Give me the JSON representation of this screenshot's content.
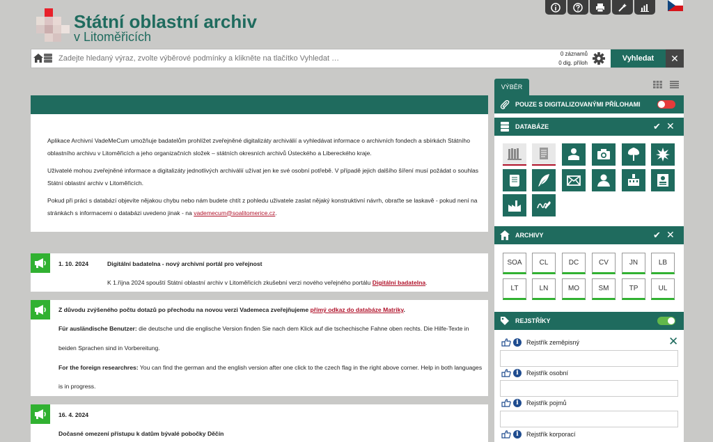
{
  "header": {
    "title_line1": "Státní oblastní archiv",
    "title_line2": "v Litoměřicích",
    "top_icons": [
      "info-icon",
      "help-icon",
      "print-icon",
      "magic-wand-icon",
      "chart-icon"
    ],
    "flag": "czech-flag-icon"
  },
  "search": {
    "placeholder": "Zadejte hledaný výraz, zvolte výběrové podmínky a klikněte na tlačítko Vyhledat …",
    "records": "0 záznamů",
    "attachments": "0 dig. příloh",
    "button": "Vyhledat",
    "clear": "✕"
  },
  "intro": {
    "p1": "Aplikace Archivní VadeMeCum umožňuje badatelům prohlížet zveřejněné digitalizáty archiválií a vyhledávat informace o archivních fondech a sbírkách Státního oblastního archivu v Litoměřicích a jeho organizačních složek – státních okresních archivů Ústeckého a Libereckého kraje.",
    "p2": "Uživatelé mohou zveřejněné informace a digitalizáty jednotlivých archiválií užívat jen ke své osobní potřebě. V případě jejich dalšího šíření musí požádat o souhlas Státní oblastní archiv v Litoměřicích.",
    "p3_before": "Pokud při práci s databází objevíte nějakou chybu nebo nám budete chtít z pohledu uživatele zaslat nějaký konstruktivní návrh, obraťte se laskavě - pokud není na stránkách s informacemi o databázi uvedeno jinak - na ",
    "p3_link": "vademecum@soalitomerice.cz",
    "p3_after": "."
  },
  "news": [
    {
      "date": "1. 10. 2024",
      "title": "Digitální badatelna - nový archivní portál pro veřejnost",
      "text_before": "K 1.října 2024 spouští Státní oblastní archiv v Litoměřicích zkušební verzi nového veřejného portálu ",
      "link": "Digitální badatelna",
      "text_after": "."
    },
    {
      "lead_before": "Z důvodu zvýšeného počtu dotazů po přechodu na novou verzi Vademeca zveřejňujeme ",
      "lead_link": "přímý odkaz do databáze Matriky",
      "lead_after": ".",
      "de_label": "Für ausländische Benutzer:",
      "de_text": " die deutsche und die englische Version finden Sie nach dem Klick auf die tschechische Fahne oben rechts. Die Hilfe-Texte in",
      "de_text2": "beiden Sprachen sind in Vorbereitung.",
      "en_label": "For the foreign researchres:",
      "en_text": " You can find the german and the english version after one click to the czech flag in the right above corner. Help in both languages",
      "en_text2": "is in progress."
    },
    {
      "date": "16. 4. 2024",
      "title": "Dočasné omezení přístupu k datům bývalé pobočky Děčín"
    }
  ],
  "sidebar": {
    "tab": "VÝBĚR",
    "digital_only": {
      "label": "POUZE S DIGITALIZOVANÝMI PŘÍLOHAMI",
      "on": false
    },
    "databases": {
      "label": "DATABÁZE",
      "icons": [
        "books-icon",
        "document-icon",
        "reader-icon",
        "camera-icon",
        "tree-icon",
        "seal-icon",
        "scroll-icon",
        "feather-icon",
        "envelope-icon",
        "person-icon",
        "building-icon",
        "portrait-icon",
        "factory-icon",
        "signature-icon"
      ]
    },
    "archives": {
      "label": "ARCHIVY",
      "codes": [
        "SOA",
        "CL",
        "DC",
        "CV",
        "JN",
        "LB",
        "LT",
        "LN",
        "MO",
        "SM",
        "TP",
        "UL"
      ]
    },
    "registers": {
      "label": "REJSTŘÍKY",
      "on": true,
      "items": [
        "Rejstřík zeměpisný",
        "Rejstřík osobní",
        "Rejstřík pojmů",
        "Rejstřík korporací"
      ]
    }
  },
  "colors": {
    "accent": "#1f6b5e",
    "green": "#31b131",
    "red": "#b0122a"
  }
}
